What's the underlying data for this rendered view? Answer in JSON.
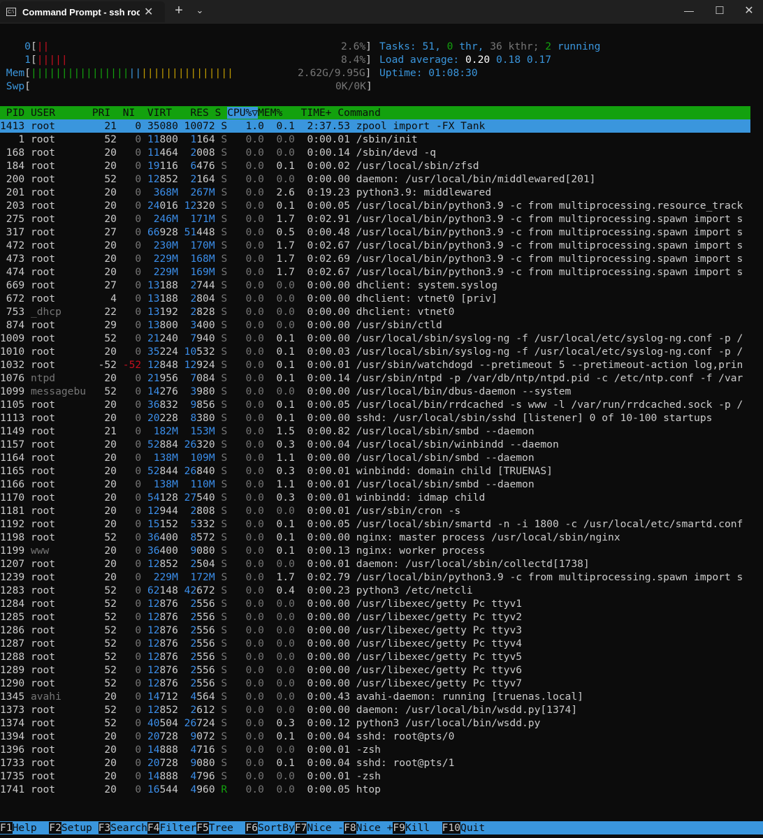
{
  "window": {
    "tab_title": "Command Prompt - ssh  root@",
    "tab_icon": "terminal-icon"
  },
  "meters": {
    "cpu0_label": "0",
    "cpu0_bar_red": "||",
    "cpu0_pct": "2.6%",
    "cpu1_label": "1",
    "cpu1_bar_red": "|||||",
    "cpu1_pct": "8.4%",
    "mem_label": "Mem",
    "mem_bar_green": "||||||||||||||||",
    "mem_bar_blue": "||",
    "mem_bar_yellow": "|||||||||||||||",
    "mem_value": "2.62G/9.95G",
    "swp_label": "Swp",
    "swp_value": "0K/0K"
  },
  "stats": {
    "tasks_label": "Tasks: ",
    "tasks_count": "51",
    "tasks_sep": ", ",
    "threads": "0",
    "thr_label": " thr, ",
    "kthr": "36",
    "kthr_label": " kthr; ",
    "running": "2",
    "running_label": " running",
    "load_label": "Load average: ",
    "load1": "0.20",
    "load5": "0.18",
    "load15": "0.17",
    "uptime_label": "Uptime: ",
    "uptime": "01:08:30"
  },
  "columns": {
    "pid": "PID",
    "user": "USER",
    "pri": "PRI",
    "ni": "NI",
    "virt": "VIRT",
    "res": "RES",
    "s": "S",
    "cpu": "CPU%▽",
    "mem": "MEM%",
    "time": "TIME+",
    "command": "Command"
  },
  "processes": [
    [
      "1413",
      "root",
      "21",
      "0",
      "35080",
      "10072",
      "S",
      "1.0",
      "0.1",
      "2:37.53",
      "zpool import -FX Tank"
    ],
    [
      "1",
      "root",
      "52",
      "0",
      "11800",
      "1164",
      "S",
      "0.0",
      "0.0",
      "0:00.01",
      "/sbin/init"
    ],
    [
      "168",
      "root",
      "20",
      "0",
      "11464",
      "2008",
      "S",
      "0.0",
      "0.0",
      "0:00.14",
      "/sbin/devd -q"
    ],
    [
      "184",
      "root",
      "20",
      "0",
      "19116",
      "6476",
      "S",
      "0.0",
      "0.1",
      "0:00.02",
      "/usr/local/sbin/zfsd"
    ],
    [
      "200",
      "root",
      "52",
      "0",
      "12852",
      "2164",
      "S",
      "0.0",
      "0.0",
      "0:00.00",
      "daemon: /usr/local/bin/middlewared[201]"
    ],
    [
      "201",
      "root",
      "20",
      "0",
      "368M",
      "267M",
      "S",
      "0.0",
      "2.6",
      "0:19.23",
      "python3.9: middlewared"
    ],
    [
      "203",
      "root",
      "20",
      "0",
      "24016",
      "12320",
      "S",
      "0.0",
      "0.1",
      "0:00.05",
      "/usr/local/bin/python3.9 -c from multiprocessing.resource_track"
    ],
    [
      "275",
      "root",
      "20",
      "0",
      "246M",
      "171M",
      "S",
      "0.0",
      "1.7",
      "0:02.91",
      "/usr/local/bin/python3.9 -c from multiprocessing.spawn import s"
    ],
    [
      "317",
      "root",
      "27",
      "0",
      "66928",
      "51448",
      "S",
      "0.0",
      "0.5",
      "0:00.48",
      "/usr/local/bin/python3.9 -c from multiprocessing.spawn import s"
    ],
    [
      "472",
      "root",
      "20",
      "0",
      "230M",
      "170M",
      "S",
      "0.0",
      "1.7",
      "0:02.67",
      "/usr/local/bin/python3.9 -c from multiprocessing.spawn import s"
    ],
    [
      "473",
      "root",
      "20",
      "0",
      "229M",
      "168M",
      "S",
      "0.0",
      "1.7",
      "0:02.69",
      "/usr/local/bin/python3.9 -c from multiprocessing.spawn import s"
    ],
    [
      "474",
      "root",
      "20",
      "0",
      "229M",
      "169M",
      "S",
      "0.0",
      "1.7",
      "0:02.67",
      "/usr/local/bin/python3.9 -c from multiprocessing.spawn import s"
    ],
    [
      "669",
      "root",
      "27",
      "0",
      "13188",
      "2744",
      "S",
      "0.0",
      "0.0",
      "0:00.00",
      "dhclient: system.syslog"
    ],
    [
      "672",
      "root",
      "4",
      "0",
      "13188",
      "2804",
      "S",
      "0.0",
      "0.0",
      "0:00.00",
      "dhclient: vtnet0 [priv]"
    ],
    [
      "753",
      "_dhcp",
      "22",
      "0",
      "13192",
      "2828",
      "S",
      "0.0",
      "0.0",
      "0:00.00",
      "dhclient: vtnet0"
    ],
    [
      "874",
      "root",
      "29",
      "0",
      "13800",
      "3400",
      "S",
      "0.0",
      "0.0",
      "0:00.00",
      "/usr/sbin/ctld"
    ],
    [
      "1009",
      "root",
      "52",
      "0",
      "21240",
      "7940",
      "S",
      "0.0",
      "0.1",
      "0:00.00",
      "/usr/local/sbin/syslog-ng -f /usr/local/etc/syslog-ng.conf -p /"
    ],
    [
      "1010",
      "root",
      "20",
      "0",
      "35224",
      "10532",
      "S",
      "0.0",
      "0.1",
      "0:00.03",
      "/usr/local/sbin/syslog-ng -f /usr/local/etc/syslog-ng.conf -p /"
    ],
    [
      "1032",
      "root",
      "-52",
      "-52",
      "12848",
      "12924",
      "S",
      "0.0",
      "0.1",
      "0:00.01",
      "/usr/sbin/watchdogd --pretimeout 5 --pretimeout-action log,prin"
    ],
    [
      "1076",
      "ntpd",
      "20",
      "0",
      "21956",
      "7084",
      "S",
      "0.0",
      "0.1",
      "0:00.14",
      "/usr/sbin/ntpd -p /var/db/ntp/ntpd.pid -c /etc/ntp.conf -f /var"
    ],
    [
      "1099",
      "messagebu",
      "52",
      "0",
      "14276",
      "3980",
      "S",
      "0.0",
      "0.0",
      "0:00.00",
      "/usr/local/bin/dbus-daemon --system"
    ],
    [
      "1105",
      "root",
      "20",
      "0",
      "36832",
      "9856",
      "S",
      "0.0",
      "0.1",
      "0:00.05",
      "/usr/local/bin/rrdcached -s www -l /var/run/rrdcached.sock -p /"
    ],
    [
      "1113",
      "root",
      "20",
      "0",
      "20228",
      "8380",
      "S",
      "0.0",
      "0.1",
      "0:00.00",
      "sshd: /usr/local/sbin/sshd [listener] 0 of 10-100 startups"
    ],
    [
      "1149",
      "root",
      "21",
      "0",
      "182M",
      "153M",
      "S",
      "0.0",
      "1.5",
      "0:00.82",
      "/usr/local/sbin/smbd --daemon"
    ],
    [
      "1157",
      "root",
      "20",
      "0",
      "52884",
      "26320",
      "S",
      "0.0",
      "0.3",
      "0:00.04",
      "/usr/local/sbin/winbindd --daemon"
    ],
    [
      "1164",
      "root",
      "20",
      "0",
      "138M",
      "109M",
      "S",
      "0.0",
      "1.1",
      "0:00.00",
      "/usr/local/sbin/smbd --daemon"
    ],
    [
      "1165",
      "root",
      "20",
      "0",
      "52844",
      "26840",
      "S",
      "0.0",
      "0.3",
      "0:00.01",
      "winbindd: domain child [TRUENAS]"
    ],
    [
      "1166",
      "root",
      "20",
      "0",
      "138M",
      "110M",
      "S",
      "0.0",
      "1.1",
      "0:00.01",
      "/usr/local/sbin/smbd --daemon"
    ],
    [
      "1170",
      "root",
      "20",
      "0",
      "54128",
      "27540",
      "S",
      "0.0",
      "0.3",
      "0:00.01",
      "winbindd: idmap child"
    ],
    [
      "1181",
      "root",
      "20",
      "0",
      "12944",
      "2808",
      "S",
      "0.0",
      "0.0",
      "0:00.01",
      "/usr/sbin/cron -s"
    ],
    [
      "1192",
      "root",
      "20",
      "0",
      "15152",
      "5332",
      "S",
      "0.0",
      "0.1",
      "0:00.05",
      "/usr/local/sbin/smartd -n -i 1800 -c /usr/local/etc/smartd.conf"
    ],
    [
      "1198",
      "root",
      "52",
      "0",
      "36400",
      "8572",
      "S",
      "0.0",
      "0.1",
      "0:00.00",
      "nginx: master process /usr/local/sbin/nginx"
    ],
    [
      "1199",
      "www",
      "20",
      "0",
      "36400",
      "9080",
      "S",
      "0.0",
      "0.1",
      "0:00.13",
      "nginx: worker process"
    ],
    [
      "1207",
      "root",
      "20",
      "0",
      "12852",
      "2504",
      "S",
      "0.0",
      "0.0",
      "0:00.01",
      "daemon: /usr/local/sbin/collectd[1738]"
    ],
    [
      "1239",
      "root",
      "20",
      "0",
      "229M",
      "172M",
      "S",
      "0.0",
      "1.7",
      "0:02.79",
      "/usr/local/bin/python3.9 -c from multiprocessing.spawn import s"
    ],
    [
      "1283",
      "root",
      "52",
      "0",
      "62148",
      "42672",
      "S",
      "0.0",
      "0.4",
      "0:00.23",
      "python3 /etc/netcli"
    ],
    [
      "1284",
      "root",
      "52",
      "0",
      "12876",
      "2556",
      "S",
      "0.0",
      "0.0",
      "0:00.00",
      "/usr/libexec/getty Pc ttyv1"
    ],
    [
      "1285",
      "root",
      "52",
      "0",
      "12876",
      "2556",
      "S",
      "0.0",
      "0.0",
      "0:00.00",
      "/usr/libexec/getty Pc ttyv2"
    ],
    [
      "1286",
      "root",
      "52",
      "0",
      "12876",
      "2556",
      "S",
      "0.0",
      "0.0",
      "0:00.00",
      "/usr/libexec/getty Pc ttyv3"
    ],
    [
      "1287",
      "root",
      "52",
      "0",
      "12876",
      "2556",
      "S",
      "0.0",
      "0.0",
      "0:00.00",
      "/usr/libexec/getty Pc ttyv4"
    ],
    [
      "1288",
      "root",
      "52",
      "0",
      "12876",
      "2556",
      "S",
      "0.0",
      "0.0",
      "0:00.00",
      "/usr/libexec/getty Pc ttyv5"
    ],
    [
      "1289",
      "root",
      "52",
      "0",
      "12876",
      "2556",
      "S",
      "0.0",
      "0.0",
      "0:00.00",
      "/usr/libexec/getty Pc ttyv6"
    ],
    [
      "1290",
      "root",
      "52",
      "0",
      "12876",
      "2556",
      "S",
      "0.0",
      "0.0",
      "0:00.00",
      "/usr/libexec/getty Pc ttyv7"
    ],
    [
      "1345",
      "avahi",
      "20",
      "0",
      "14712",
      "4564",
      "S",
      "0.0",
      "0.0",
      "0:00.43",
      "avahi-daemon: running [truenas.local]"
    ],
    [
      "1373",
      "root",
      "52",
      "0",
      "12852",
      "2612",
      "S",
      "0.0",
      "0.0",
      "0:00.00",
      "daemon: /usr/local/bin/wsdd.py[1374]"
    ],
    [
      "1374",
      "root",
      "52",
      "0",
      "40504",
      "26724",
      "S",
      "0.0",
      "0.3",
      "0:00.12",
      "python3 /usr/local/bin/wsdd.py"
    ],
    [
      "1394",
      "root",
      "20",
      "0",
      "20728",
      "9072",
      "S",
      "0.0",
      "0.1",
      "0:00.04",
      "sshd: root@pts/0"
    ],
    [
      "1396",
      "root",
      "20",
      "0",
      "14888",
      "4716",
      "S",
      "0.0",
      "0.0",
      "0:00.01",
      "-zsh"
    ],
    [
      "1733",
      "root",
      "20",
      "0",
      "20728",
      "9080",
      "S",
      "0.0",
      "0.1",
      "0:00.04",
      "sshd: root@pts/1"
    ],
    [
      "1735",
      "root",
      "20",
      "0",
      "14888",
      "4796",
      "S",
      "0.0",
      "0.0",
      "0:00.01",
      "-zsh"
    ],
    [
      "1741",
      "root",
      "20",
      "0",
      "16544",
      "4960",
      "R",
      "0.0",
      "0.0",
      "0:00.05",
      "htop"
    ]
  ],
  "fkeys": [
    {
      "key": "F1",
      "label": "Help  "
    },
    {
      "key": "F2",
      "label": "Setup "
    },
    {
      "key": "F3",
      "label": "Search"
    },
    {
      "key": "F4",
      "label": "Filter"
    },
    {
      "key": "F5",
      "label": "Tree  "
    },
    {
      "key": "F6",
      "label": "SortBy"
    },
    {
      "key": "F7",
      "label": "Nice -"
    },
    {
      "key": "F8",
      "label": "Nice +"
    },
    {
      "key": "F9",
      "label": "Kill  "
    },
    {
      "key": "F10",
      "label": "Quit  "
    }
  ]
}
